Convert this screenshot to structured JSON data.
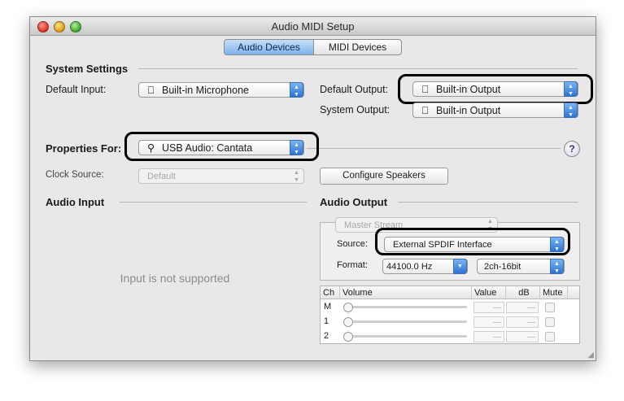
{
  "window": {
    "title": "Audio MIDI Setup"
  },
  "tabs": [
    {
      "label": "Audio Devices",
      "selected": true
    },
    {
      "label": "MIDI Devices",
      "selected": false
    }
  ],
  "system_settings": {
    "heading": "System Settings",
    "default_input_label": "Default Input:",
    "default_input_value": "Built-in Microphone",
    "default_output_label": "Default Output:",
    "default_output_value": "Built-in Output",
    "system_output_label": "System Output:",
    "system_output_value": "Built-in Output"
  },
  "properties": {
    "label": "Properties For:",
    "device": "USB Audio: Cantata",
    "help": "?",
    "clock_source_label": "Clock Source:",
    "clock_source_value": "Default",
    "configure_speakers": "Configure Speakers"
  },
  "audio_input": {
    "heading": "Audio Input",
    "message": "Input is not supported"
  },
  "audio_output": {
    "heading": "Audio Output",
    "stream": "Master Stream",
    "source_label": "Source:",
    "source_value": "External SPDIF Interface",
    "format_label": "Format:",
    "format_rate": "44100.0 Hz",
    "format_bits": "2ch-16bit",
    "columns": [
      "Ch",
      "Volume",
      "Value",
      "dB",
      "Mute"
    ],
    "channels": [
      {
        "ch": "M",
        "value": "—",
        "db": "—"
      },
      {
        "ch": "1",
        "value": "—",
        "db": "—"
      },
      {
        "ch": "2",
        "value": "—",
        "db": "—"
      }
    ]
  },
  "colors": {
    "accent": "#2c73d6",
    "window": "#e8e8e8",
    "highlight": "#000000"
  },
  "icons": {
    "apple": "apple-icon",
    "usb": "usb-icon"
  }
}
